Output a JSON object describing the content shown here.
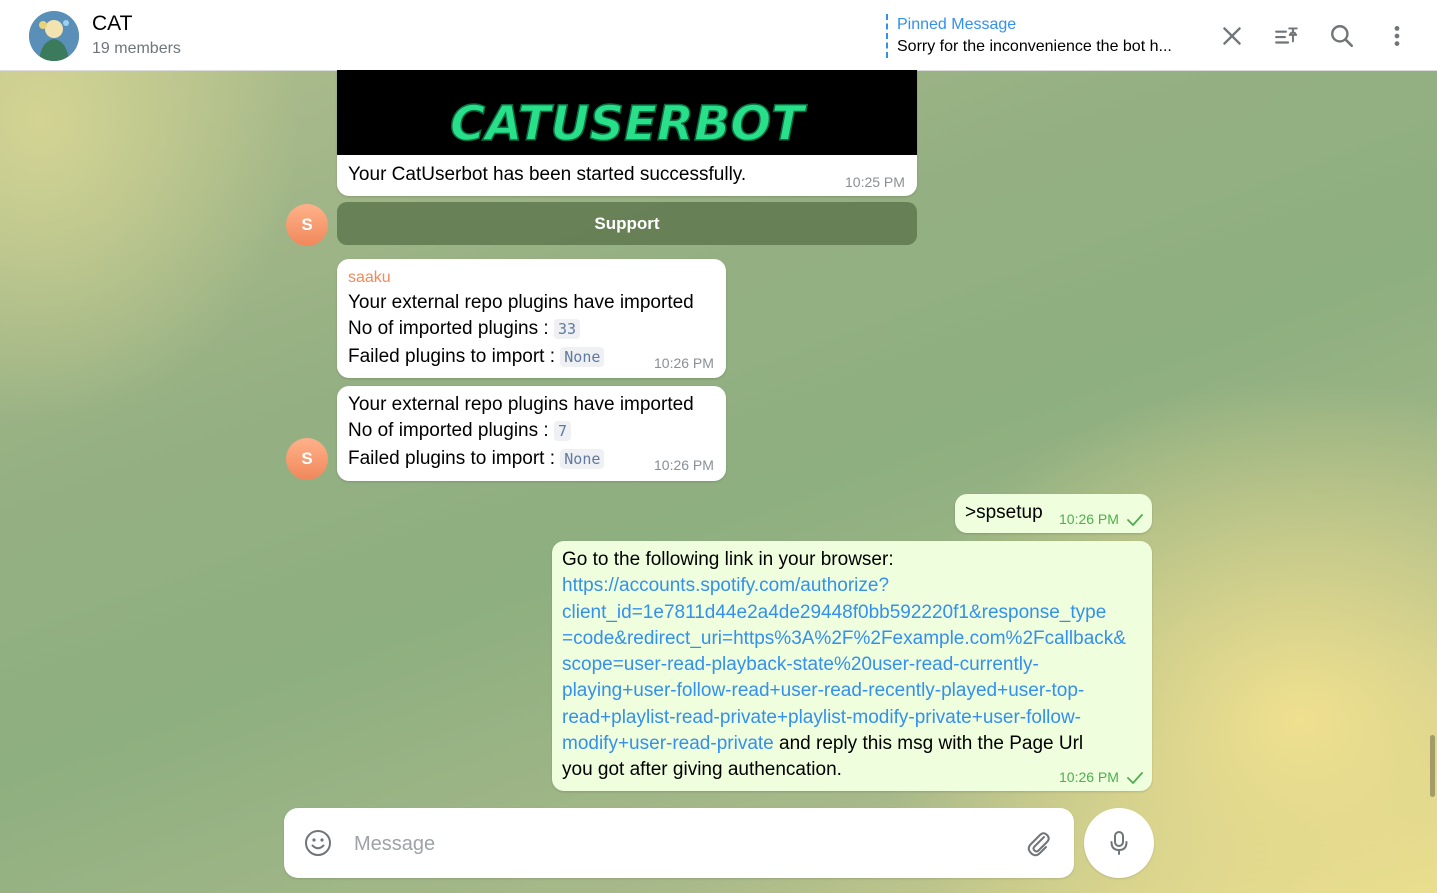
{
  "header": {
    "title": "CAT",
    "subtitle": "19 members",
    "pinned_label": "Pinned Message",
    "pinned_text": "Sorry for the inconvenience the bot h..."
  },
  "icons": {
    "close": "close-icon",
    "pinned_list": "pinned-list-icon",
    "search": "search-icon",
    "more": "more-vertical-icon"
  },
  "messages": {
    "startup": {
      "banner_text": "CATUSERBOT",
      "caption": "Your CatUserbot has been started successfully.",
      "time": "10:25 PM",
      "button": "Support"
    },
    "plugins1": {
      "sender": "saaku",
      "line1": "Your external repo plugins have imported",
      "line2_label": "No of imported plugins :",
      "line2_value": "33",
      "line3_label": "Failed plugins to import :",
      "line3_value": "None",
      "time": "10:26 PM"
    },
    "plugins2": {
      "line1": "Your external repo plugins have imported",
      "line2_label": "No of imported plugins :",
      "line2_value": "7",
      "line3_label": "Failed plugins to import :",
      "line3_value": "None",
      "time": "10:26 PM"
    },
    "avatar_letter": "S",
    "spsetup": {
      "text": ">spsetup",
      "time": "10:26 PM"
    },
    "link_msg": {
      "intro": "Go to the following link in your browser:",
      "link_lines": [
        "https://accounts.spotify.com/authorize?",
        "client_id=1e7811d44e2a4de29448f0bb592220f1&response_type",
        "=code&redirect_uri=https%3A%2F%2Fexample.com%2Fcallback&",
        "scope=user-read-playback-state%20user-read-currently-",
        "playing+user-follow-read+user-read-recently-played+user-top-",
        "read+playlist-read-private+playlist-modify-private+user-follow-",
        "modify+user-read-private"
      ],
      "tail1": " and reply this msg with the Page Url",
      "tail2": "you got after giving authencation.",
      "time": "10:26 PM"
    }
  },
  "composer": {
    "placeholder": "Message"
  },
  "colors": {
    "accent": "#3390ec",
    "outgoing_bubble": "#effedd",
    "sender_name": "#f5885a",
    "read_check": "#4fae4e",
    "banner_text": "#28e08a"
  }
}
